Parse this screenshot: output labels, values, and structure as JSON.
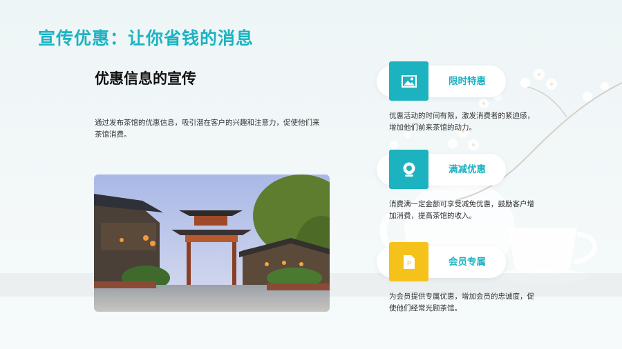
{
  "title": "宣传优惠：让你省钱的消息",
  "subtitle": "优惠信息的宣传",
  "description": "通过发布茶馆的优惠信息，吸引潜在客户的兴趣和注意力，促使他们来茶馆消费。",
  "colors": {
    "accent": "#1bb3c2",
    "teal": "#1db2bf",
    "gold": "#f5c21b"
  },
  "cards": [
    {
      "label": "限时特惠",
      "icon": "image-icon",
      "text": "优惠活动的时间有限，激发消费者的紧迫感，增加他们前来茶馆的动力。"
    },
    {
      "label": "满减优惠",
      "icon": "webcam-icon",
      "text": "消费满一定金额可享受减免优惠，鼓励客户增加消费，提高茶馆的收入。"
    },
    {
      "label": "会员专属",
      "icon": "document-icon",
      "text": "为会员提供专属优惠，增加会员的忠诚度，促使他们经常光顾茶馆。"
    }
  ]
}
